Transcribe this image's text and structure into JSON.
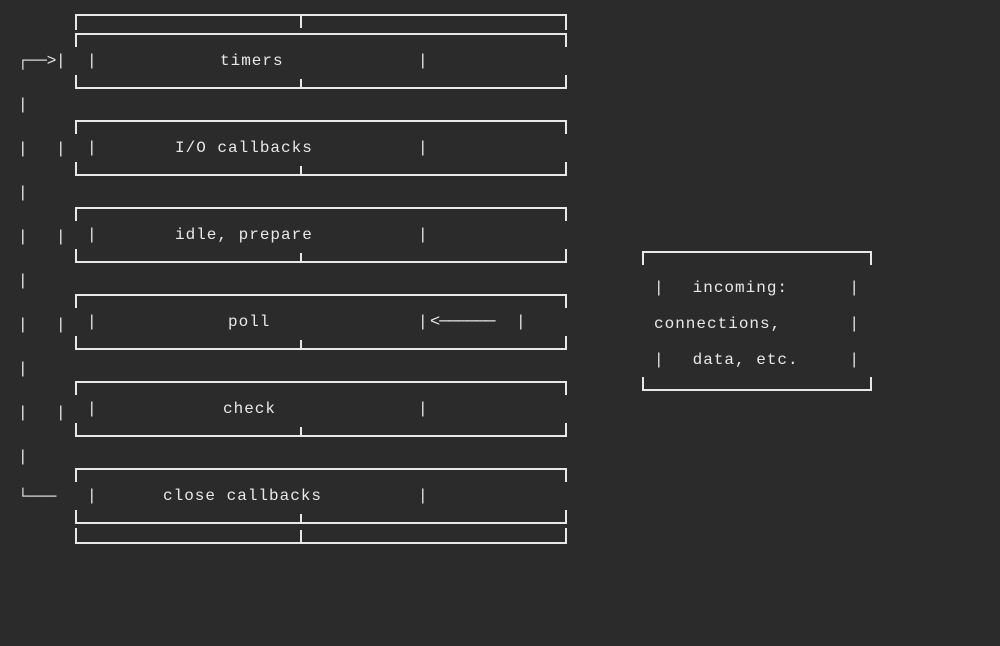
{
  "diagram": {
    "phases": [
      {
        "label": "timers"
      },
      {
        "label": "I/O callbacks"
      },
      {
        "label": "idle, prepare"
      },
      {
        "label": "poll"
      },
      {
        "label": "check"
      },
      {
        "label": "close callbacks"
      }
    ],
    "incoming": {
      "line1": "incoming:",
      "line2": "connections,",
      "line3": "data, etc."
    },
    "symbols": {
      "pipe": "|",
      "arrow_right": "─>",
      "arrow_left": "<─"
    }
  }
}
